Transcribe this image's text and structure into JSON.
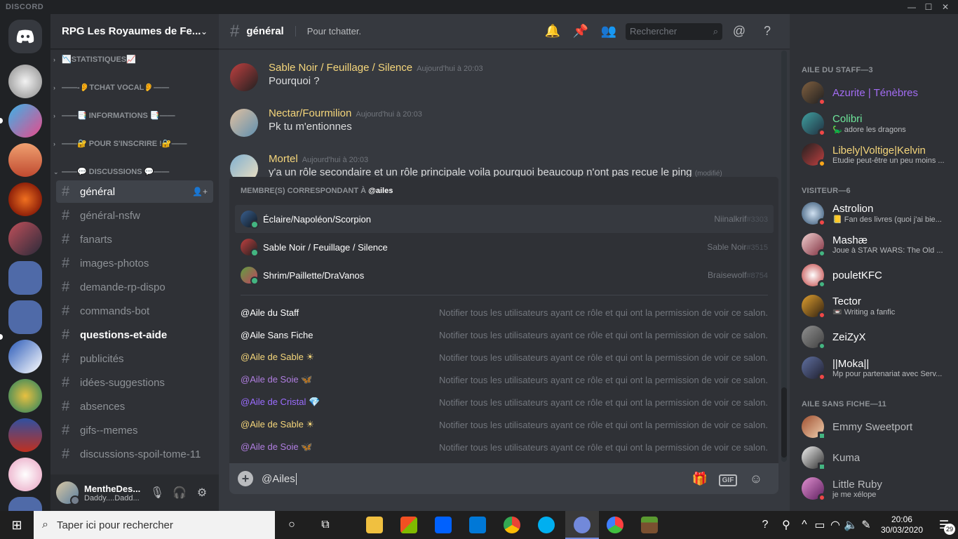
{
  "app": {
    "brand": "DISCORD"
  },
  "server": {
    "name": "RPG Les Royaumes de Fe..."
  },
  "categories": [
    {
      "label": "📉STATISTIQUES📈",
      "collapsed": true
    },
    {
      "label": "——-👂TCHAT VOCAL👂——",
      "collapsed": true
    },
    {
      "label": "——📑 INFORMATIONS 📑——",
      "collapsed": true
    },
    {
      "label": "——🔐 POUR S'INSCRIRE !🔐——",
      "collapsed": true
    },
    {
      "label": "——💬 DISCUSSIONS 💬——",
      "collapsed": false
    }
  ],
  "channels": [
    {
      "name": "général",
      "state": "active"
    },
    {
      "name": "général-nsfw",
      "state": "normal"
    },
    {
      "name": "fanarts",
      "state": "normal"
    },
    {
      "name": "images-photos",
      "state": "normal"
    },
    {
      "name": "demande-rp-dispo",
      "state": "normal"
    },
    {
      "name": "commands-bot",
      "state": "normal"
    },
    {
      "name": "questions-et-aide",
      "state": "unread"
    },
    {
      "name": "publicités",
      "state": "normal"
    },
    {
      "name": "idées-suggestions",
      "state": "normal"
    },
    {
      "name": "absences",
      "state": "normal"
    },
    {
      "name": "gifs--memes",
      "state": "normal"
    },
    {
      "name": "discussions-spoil-tome-11",
      "state": "normal"
    }
  ],
  "current_user": {
    "name": "MentheDes...",
    "status": "Daddy....Dadd..."
  },
  "channel_header": {
    "name": "général",
    "topic": "Pour tchatter.",
    "search_placeholder": "Rechercher"
  },
  "messages": [
    {
      "author": "Sable Noir / Feuillage / Silence",
      "time": "Aujourd'hui à 20:03",
      "text": "Pourquoi ?",
      "edited": ""
    },
    {
      "author": "Nectar/Fourmilion",
      "time": "Aujourd'hui à 20:03",
      "text": "Pk tu m'entionnes",
      "edited": ""
    },
    {
      "author": "Mortel",
      "time": "Aujourd'hui à 20:03",
      "text": "y'a un rôle secondaire et un rôle principale voila pourquoi beaucoup n'ont pas recue le ping",
      "edited": "(modifié)"
    }
  ],
  "autocomplete": {
    "header_prefix": "Membre(s) correspondant à",
    "query": "@ailes",
    "members": [
      {
        "name": "Éclaire/Napoléon/Scorpion",
        "user": "Niinalkrif",
        "disc": "#3303",
        "selected": true
      },
      {
        "name": "Sable Noir / Feuillage / Silence",
        "user": "Sable Noir",
        "disc": "#3515",
        "selected": false
      },
      {
        "name": "Shrim/Paillette/DraVanos",
        "user": "Braisewolf",
        "disc": "#8754",
        "selected": false
      }
    ],
    "role_description": "Notifier tous les utilisateurs ayant ce rôle et qui ont la permission de voir ce salon.",
    "roles": [
      {
        "name": "@Aile du Staff",
        "color": "#ffffff"
      },
      {
        "name": "@Aile Sans Fiche",
        "color": "#ffffff"
      },
      {
        "name": "@Aile de Sable ☀",
        "color": "#f5d67b"
      },
      {
        "name": "@Aile de Soie 🦋",
        "color": "#b07ee0"
      },
      {
        "name": "@Aile de Cristal 💎",
        "color": "#9b6cff"
      },
      {
        "name": "@Aile de Sable ☀",
        "color": "#f5d67b"
      },
      {
        "name": "@Aile de Soie 🦋",
        "color": "#b07ee0"
      }
    ]
  },
  "composer": {
    "value": "@Ailes"
  },
  "member_groups": [
    {
      "label": "AILE DU STAFF—3"
    },
    {
      "label": "VISITEUR—6"
    },
    {
      "label": "AILE SANS FICHE—11"
    }
  ],
  "members": [
    {
      "name": "Azurite | Ténèbres",
      "status": "",
      "color": "#a26cf2",
      "presence": "dnd"
    },
    {
      "name": "Colibri",
      "status": "🦕 adore les dragons",
      "color": "#6ee69b",
      "presence": "dnd"
    },
    {
      "name": "Libely|Voltige|Kelvin",
      "status": "Etudie peut-être un peu moins ...",
      "color": "#f5d67b",
      "presence": "idle"
    },
    {
      "name": "Astrolion",
      "status": "📒 Fan des livres (quoi j'ai bie...",
      "color": "#ffffff",
      "presence": "dnd"
    },
    {
      "name": "Mashæ",
      "status": "Joue à STAR WARS: The Old ...",
      "color": "#ffffff",
      "presence": "online"
    },
    {
      "name": "pouletKFC",
      "status": "",
      "color": "#ffffff",
      "presence": "online"
    },
    {
      "name": "Tector",
      "status": "📼 Writing a fanfic",
      "color": "#ffffff",
      "presence": "dnd"
    },
    {
      "name": "ZeiZyX",
      "status": "",
      "color": "#ffffff",
      "presence": "online"
    },
    {
      "name": "||Moka||",
      "status": "Mp pour partenariat avec Serv...",
      "color": "#ffffff",
      "presence": "dnd"
    },
    {
      "name": "Emmy Sweetport",
      "status": "",
      "color": "#b9bbbe",
      "presence": "mobile"
    },
    {
      "name": "Kuma",
      "status": "",
      "color": "#b9bbbe",
      "presence": "mobile"
    },
    {
      "name": "Little Ruby",
      "status": "je me xélope",
      "color": "#b9bbbe",
      "presence": "dnd"
    }
  ],
  "taskbar": {
    "search_placeholder": "Taper ici pour rechercher",
    "time": "20:06",
    "date": "30/03/2020",
    "notifications": "29"
  },
  "colors": {
    "accent": "#7289da",
    "online": "#43b581",
    "dnd": "#f04747",
    "idle": "#faa61a"
  }
}
